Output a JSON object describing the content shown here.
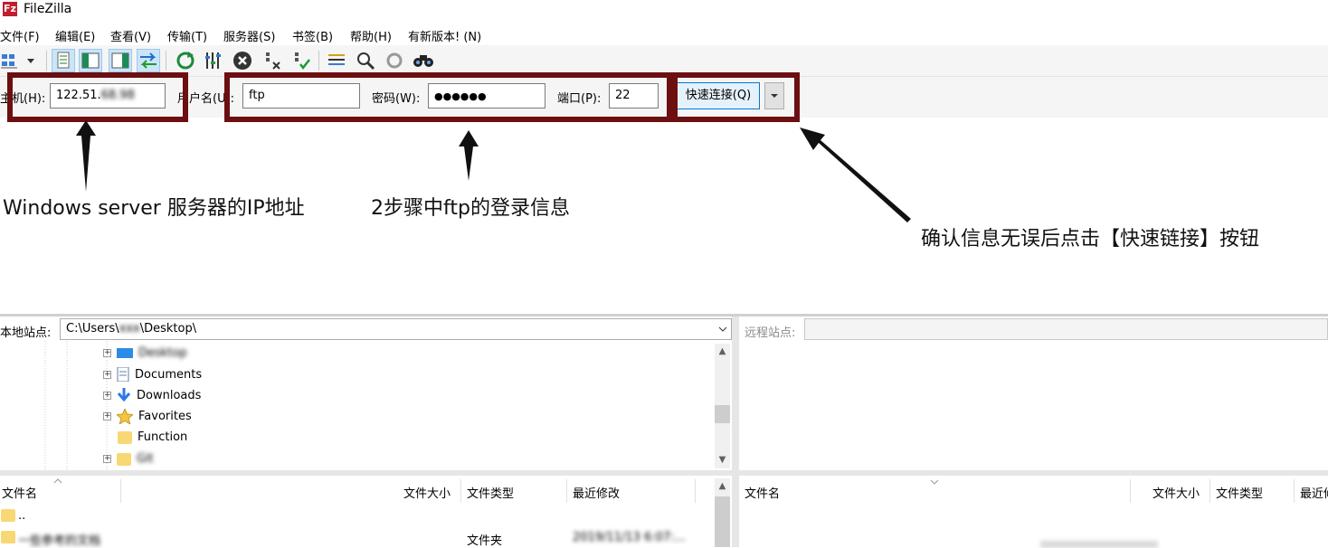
{
  "window": {
    "title": "FileZilla",
    "logo_text": "Fz"
  },
  "menu": [
    {
      "label": "文件(F)"
    },
    {
      "label": "编辑(E)"
    },
    {
      "label": "查看(V)"
    },
    {
      "label": "传输(T)"
    },
    {
      "label": "服务器(S)"
    },
    {
      "label": "书签(B)"
    },
    {
      "label": "帮助(H)"
    },
    {
      "label": "有新版本!"
    },
    {
      "label": "(N)"
    }
  ],
  "quickconnect": {
    "host_label": "主机(H):",
    "host_value": "122.51.",
    "host_hidden": "68.98",
    "user_label": "用户名(U):",
    "user_value": "ftp",
    "password_label": "密码(W):",
    "password_value": "●●●●●●",
    "port_label": "端口(P):",
    "port_value": "22",
    "connect_label": "快速连接(Q)"
  },
  "annotations": {
    "host_note": "Windows server 服务器的IP地址",
    "login_note": "2步骤中ftp的登录信息",
    "connect_note": "确认信息无误后点击【快速链接】按钮"
  },
  "local": {
    "site_label": "本地站点:",
    "path": "C:\\Users\\",
    "path_hidden": "xxx",
    "path_mid": "\\Desktop\\",
    "tree": [
      {
        "label": "Desktop",
        "icon": "desktop-icon"
      },
      {
        "label": "Documents",
        "icon": "document-icon"
      },
      {
        "label": "Downloads",
        "icon": "download-icon"
      },
      {
        "label": "Favorites",
        "icon": "star-icon"
      },
      {
        "label": "Function",
        "icon": "folder-icon"
      },
      {
        "label": "Git",
        "icon": "folder-icon"
      }
    ],
    "columns": [
      "文件名",
      "文件大小",
      "文件类型",
      "最近修改"
    ],
    "files": [
      {
        "name": "..",
        "type": "",
        "modified": ""
      },
      {
        "name": "一些参考的文档",
        "type": "文件夹",
        "modified": "2019/11/13 6:07:..."
      }
    ]
  },
  "remote": {
    "site_label": "远程站点:",
    "columns": [
      "文件名",
      "文件大小",
      "文件类型",
      "最近修"
    ]
  },
  "colors": {
    "highlight": "#6b0f10",
    "accent": "#0078d7",
    "folder": "#f8d775"
  }
}
